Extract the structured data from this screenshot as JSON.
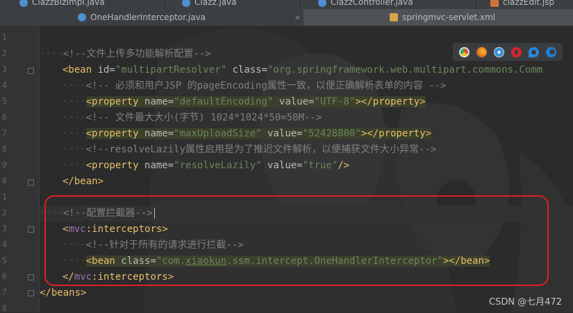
{
  "tabs_top": [
    {
      "label": "ClazzBizImpl.java",
      "icon": "java-class-icon",
      "color": "#4e8fd1"
    },
    {
      "label": "Clazz.java",
      "icon": "java-class-icon",
      "color": "#4e8fd1"
    },
    {
      "label": "ClazzController.java",
      "icon": "java-class-icon",
      "color": "#4e8fd1"
    },
    {
      "label": "clazzEdit.jsp",
      "icon": "jsp-file-icon",
      "color": "#d0733c"
    }
  ],
  "tabs_main": [
    {
      "label": "OneHandlerInterceptor.java",
      "icon": "java-class-icon",
      "color": "#4e8fd1",
      "active": false
    },
    {
      "label": "springmvc-servlet.xml",
      "icon": "xml-file-icon",
      "color": "#d8a24a",
      "active": true
    }
  ],
  "close_glyph": "×",
  "line_numbers": [
    "1",
    "2",
    "3",
    "4",
    "5",
    "6",
    "7",
    "8",
    "9",
    "0",
    "1",
    "2",
    "3",
    "4",
    "5",
    "6",
    "7",
    "8"
  ],
  "code": {
    "l1": "<!--文件上传多功能解析配置-->",
    "l2_open": "<bean ",
    "l2_a1": "id=",
    "l2_v1": "\"multipartResolver\"",
    "l2_a2": " class=",
    "l2_v2": "\"org.springframework.web.multipart.commons.Comm",
    "l3": "<!-- 必须和用户JSP 的pageEncoding属性一致，以便正确解析表单的内容 -->",
    "l4_open": "<property ",
    "l4_a1": "name=",
    "l4_v1": "\"defaultEncoding\"",
    "l4_a2": " value=",
    "l4_v2": "\"UTF-8\"",
    "l4_close": "></property>",
    "l5": "<!-- 文件最大大小(字节) 1024*1024*50=50M-->",
    "l6_open": "<property ",
    "l6_a1": "name=",
    "l6_v1": "\"maxUploadSize\"",
    "l6_a2": " value=",
    "l6_v2": "\"52428800\"",
    "l6_close": "></property>",
    "l7": "<!--resolveLazily属性启用是为了推迟文件解析，以便捕获文件大小异常-->",
    "l8_open": "<property ",
    "l8_a1": "name=",
    "l8_v1": "\"resolveLazily\"",
    "l8_a2": " value=",
    "l8_v2": "\"true\"",
    "l8_close": "/>",
    "l9": "</bean>",
    "l11": "<!--配置拦截器-->",
    "l12_lt": "<",
    "l12_ns": "mvc",
    "l12_rest": ":interceptors>",
    "l13": "<!--针对于所有的请求进行拦截-->",
    "l14_open": "<bean ",
    "l14_a1": "class=",
    "l14_v1a": "\"com.",
    "l14_v1b": "xiaokun",
    "l14_v1c": ".ssm.intercept.OneHandlerInterceptor\"",
    "l14_close": "></bean>",
    "l15_lt": "</",
    "l15_ns": "mvc",
    "l15_rest": ":interceptors>",
    "l16": "</beans>"
  },
  "indent_dots": "····",
  "indent_dots2": "········",
  "browser_icons": [
    {
      "name": "chrome-icon",
      "color": "#e24a3b"
    },
    {
      "name": "firefox-icon",
      "color": "#e6761b"
    },
    {
      "name": "safari-icon",
      "color": "#3b8fd9"
    },
    {
      "name": "opera-icon",
      "color": "#d8232a"
    },
    {
      "name": "ie-icon",
      "color": "#2b87d8"
    },
    {
      "name": "edge-icon",
      "color": "#1f7fd0"
    }
  ],
  "watermark": "CSDN @七月472",
  "highlight_color": "#e0201f"
}
